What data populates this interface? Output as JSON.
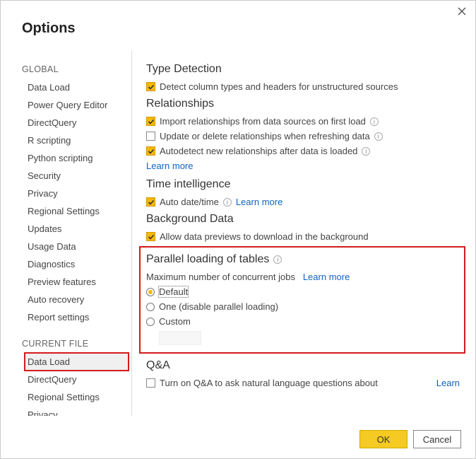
{
  "title": "Options",
  "sidebar": {
    "global_label": "GLOBAL",
    "global_items": [
      "Data Load",
      "Power Query Editor",
      "DirectQuery",
      "R scripting",
      "Python scripting",
      "Security",
      "Privacy",
      "Regional Settings",
      "Updates",
      "Usage Data",
      "Diagnostics",
      "Preview features",
      "Auto recovery",
      "Report settings"
    ],
    "current_label": "CURRENT FILE",
    "current_items": [
      "Data Load",
      "DirectQuery",
      "Regional Settings",
      "Privacy"
    ],
    "selected": "Data Load"
  },
  "sections": {
    "type_detection": {
      "title": "Type Detection",
      "opt1": "Detect column types and headers for unstructured sources"
    },
    "relationships": {
      "title": "Relationships",
      "opt1": "Import relationships from data sources on first load",
      "opt2": "Update or delete relationships when refreshing data",
      "opt3": "Autodetect new relationships after data is loaded",
      "learn": "Learn more"
    },
    "time_intel": {
      "title": "Time intelligence",
      "opt1": "Auto date/time",
      "learn": "Learn more"
    },
    "bg_data": {
      "title": "Background Data",
      "opt1": "Allow data previews to download in the background"
    },
    "parallel": {
      "title": "Parallel loading of tables",
      "sub": "Maximum number of concurrent jobs",
      "learn": "Learn more",
      "r1": "Default",
      "r2": "One (disable parallel loading)",
      "r3": "Custom"
    },
    "qna": {
      "title": "Q&A",
      "opt1": "Turn on Q&A to ask natural language questions about",
      "learn": "Learn"
    }
  },
  "footer": {
    "ok": "OK",
    "cancel": "Cancel"
  }
}
